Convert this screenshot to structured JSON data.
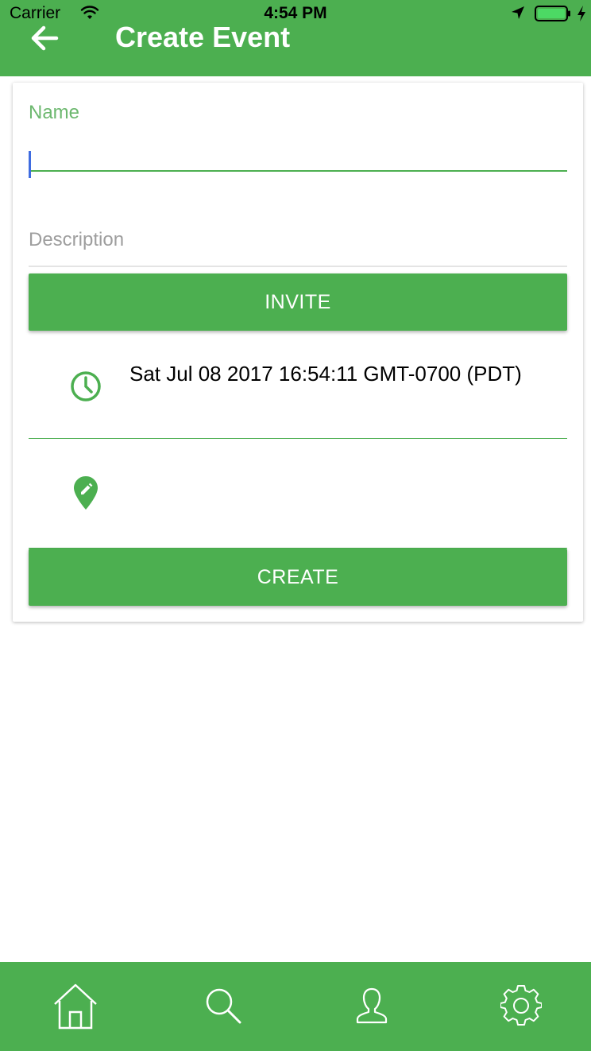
{
  "status_bar": {
    "carrier": "Carrier",
    "time": "4:54 PM",
    "icons": [
      "wifi-icon",
      "location-arrow-icon",
      "battery-icon",
      "charging-bolt-icon"
    ]
  },
  "header": {
    "title": "Create Event",
    "back_icon": "arrow-left-icon",
    "background_color": "#4CAF50"
  },
  "form": {
    "name": {
      "label": "Name",
      "value": ""
    },
    "description": {
      "placeholder": "Description",
      "value": ""
    },
    "invite_label": "INVITE",
    "date": {
      "icon": "clock-icon",
      "value": "Sat Jul 08 2017 16:54:11 GMT-0700 (PDT)"
    },
    "location": {
      "icon": "map-pin-edit-icon",
      "value": ""
    },
    "create_label": "CREATE"
  },
  "bottom_nav": {
    "items": [
      {
        "icon": "home-icon"
      },
      {
        "icon": "search-icon"
      },
      {
        "icon": "profile-icon"
      },
      {
        "icon": "gear-icon"
      }
    ]
  },
  "colors": {
    "primary": "#4CAF50",
    "label_focus": "#6DB86F",
    "cursor": "#3F6CE0"
  }
}
